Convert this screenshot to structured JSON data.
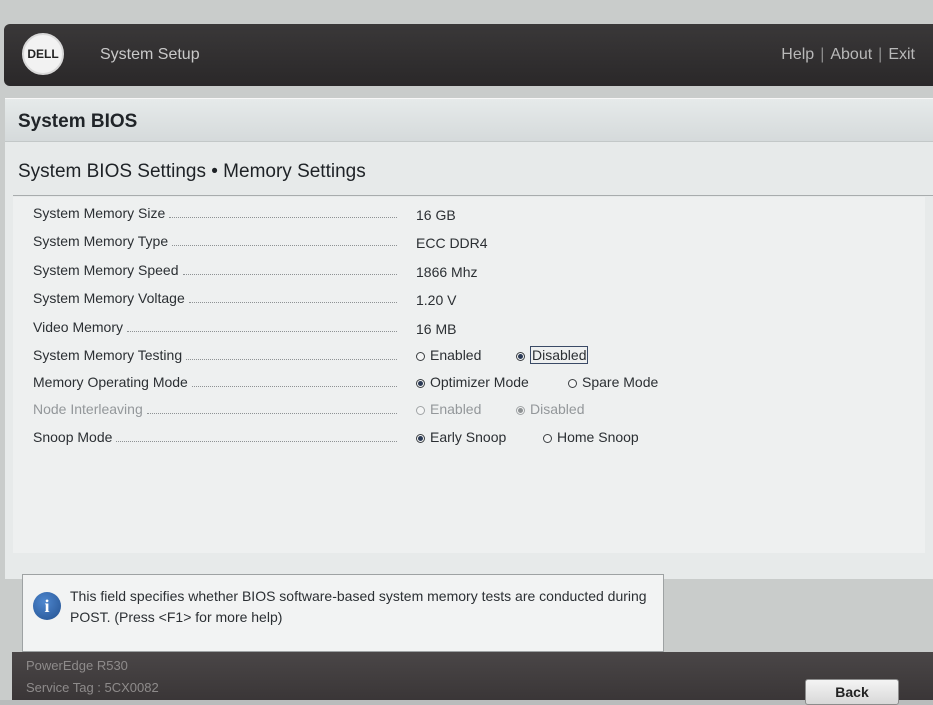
{
  "header": {
    "logo_text": "DELL",
    "app_title": "System Setup",
    "links": [
      "Help",
      "About",
      "Exit"
    ]
  },
  "section": {
    "title": "System BIOS",
    "page_title": "System BIOS Settings • Memory Settings"
  },
  "settings": [
    {
      "label": "System Memory Size",
      "value": "16 GB"
    },
    {
      "label": "System Memory Type",
      "value": "ECC DDR4"
    },
    {
      "label": "System Memory Speed",
      "value": "1866 Mhz"
    },
    {
      "label": "System Memory Voltage",
      "value": "1.20 V"
    },
    {
      "label": "Video Memory",
      "value": "16 MB"
    },
    {
      "label": "System Memory Testing",
      "options": [
        "Enabled",
        "Disabled"
      ],
      "selected": "Disabled",
      "focused": true,
      "enabled": true
    },
    {
      "label": "Memory Operating Mode",
      "options": [
        "Optimizer Mode",
        "Spare Mode"
      ],
      "selected": "Optimizer Mode",
      "enabled": true
    },
    {
      "label": "Node Interleaving",
      "options": [
        "Enabled",
        "Disabled"
      ],
      "selected": "Disabled",
      "enabled": false
    },
    {
      "label": "Snoop Mode",
      "options": [
        "Early Snoop",
        "Home Snoop"
      ],
      "selected": "Early Snoop",
      "enabled": true
    }
  ],
  "help": {
    "icon": "info-icon",
    "text": "This field specifies whether BIOS software-based system memory tests are conducted during POST. (Press <F1> for more help)"
  },
  "footer": {
    "model": "PowerEdge R530",
    "service_tag": "Service Tag : 5CX0082",
    "back_label": "Back"
  }
}
